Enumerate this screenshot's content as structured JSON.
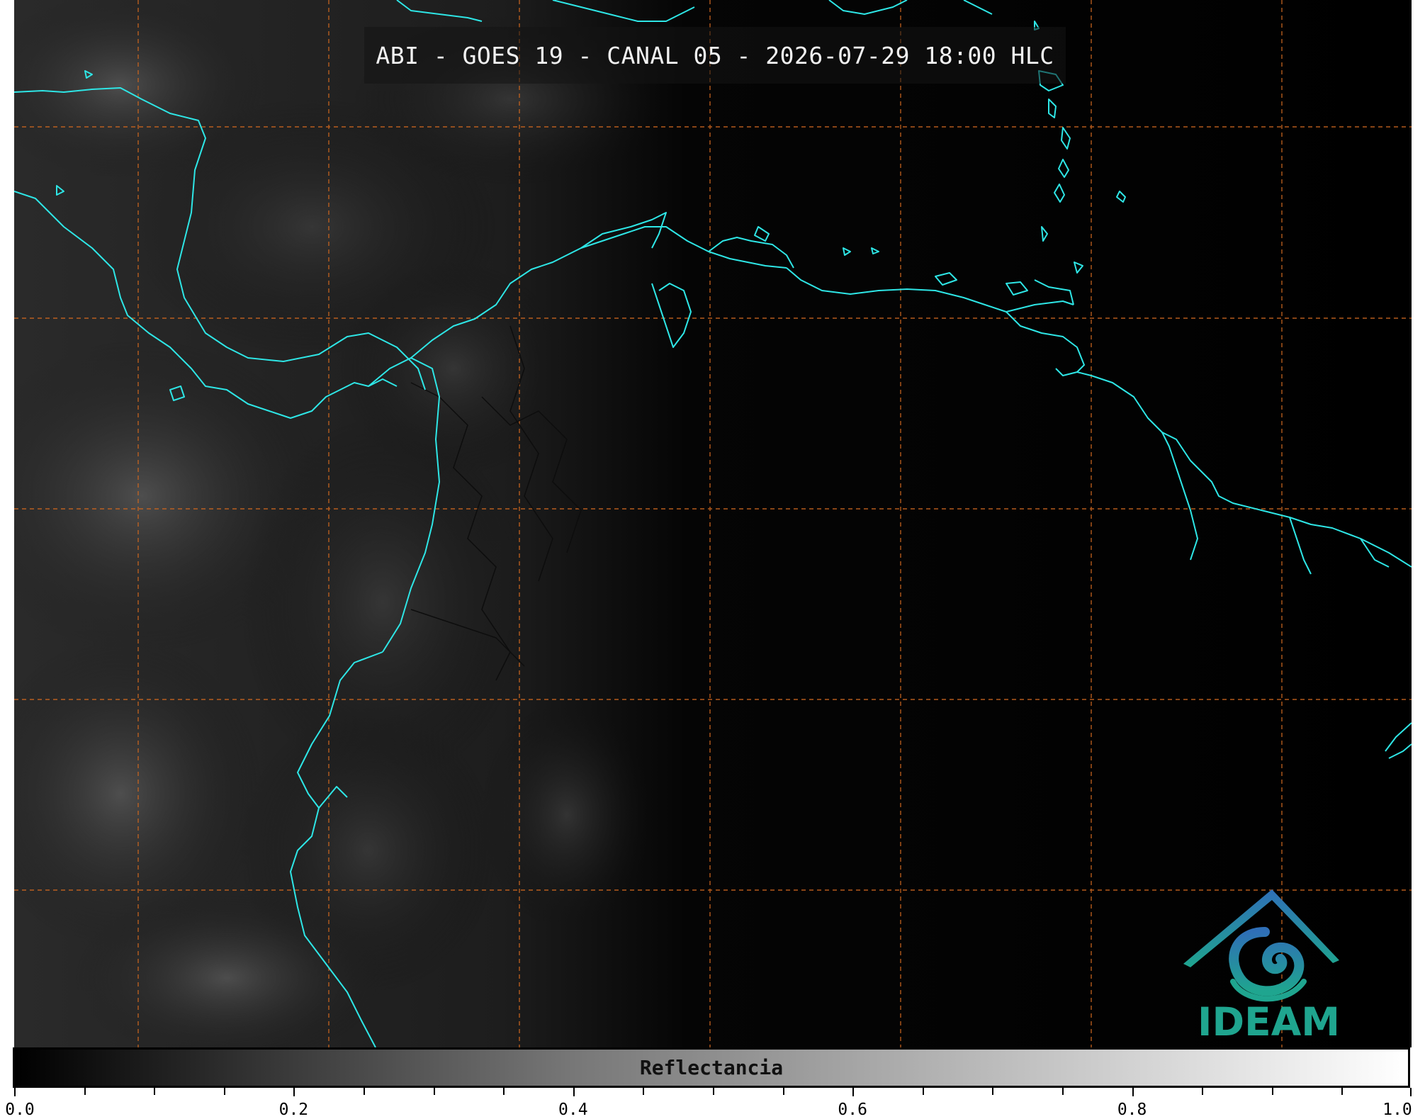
{
  "title": "ABI - GOES 19 - CANAL 05 - 2026-07-29 18:00 HLC",
  "logo": {
    "text": "IDEAM",
    "colors": {
      "primary": "#1fa58f",
      "secondary": "#2f6fb7"
    }
  },
  "colorbar": {
    "label": "Reflectancia",
    "range": [
      0.0,
      1.0
    ],
    "ticks": [
      "0.0",
      "0.2",
      "0.4",
      "0.6",
      "0.8",
      "1.0"
    ],
    "colormap": "gray"
  },
  "map": {
    "coastline_color": "#2ee6e6",
    "grid_color": "#d2691e",
    "grid_style": "dashed",
    "background": "#000000"
  }
}
